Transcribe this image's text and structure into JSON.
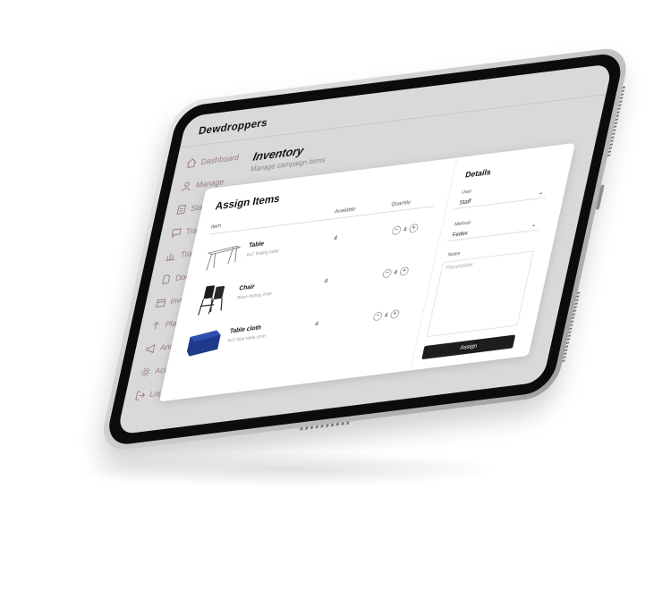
{
  "app": {
    "brand": "Dewdroppers"
  },
  "sidebar": {
    "items": [
      {
        "label": "Dashboard",
        "icon": "home-icon"
      },
      {
        "label": "Manage",
        "icon": "user-icon"
      },
      {
        "label": "Staff",
        "icon": "staff-icon"
      },
      {
        "label": "Training",
        "icon": "chat-icon"
      },
      {
        "label": "Training",
        "icon": "chart-icon"
      },
      {
        "label": "Documents",
        "icon": "document-icon"
      },
      {
        "label": "Inventory",
        "icon": "inventory-icon"
      },
      {
        "label": "Plan Upload",
        "icon": "upload-icon"
      },
      {
        "label": "Announcements",
        "icon": "megaphone-icon"
      },
      {
        "label": "Accounts",
        "icon": "gear-icon"
      },
      {
        "label": "Logout",
        "icon": "logout-icon"
      }
    ]
  },
  "main": {
    "title": "Inventory",
    "subtitle": "Manage campaign items"
  },
  "modal": {
    "title": "Assign Items",
    "columns": {
      "item": "Item",
      "available": "Available",
      "quantity": "Quantity"
    },
    "items": [
      {
        "name": "Table",
        "desc": "6x2' folding table",
        "available": "4",
        "quantity": "4",
        "image": "table-image"
      },
      {
        "name": "Chair",
        "desc": "Black folding chair",
        "available": "4",
        "quantity": "4",
        "image": "chair-image"
      },
      {
        "name": "Table cloth",
        "desc": "6x2' blue table cloth",
        "available": "4",
        "quantity": "4",
        "image": "tablecloth-image"
      }
    ],
    "details": {
      "title": "Details",
      "user_label": "User",
      "user_value": "Staff",
      "method_label": "Method",
      "method_value": "Fedex",
      "notes_label": "Notes",
      "notes_placeholder": "Placeholder",
      "assign_label": "Assign"
    },
    "stepper": {
      "minus": "−",
      "plus": "+"
    }
  },
  "colors": {
    "accent": "#9a7d86",
    "button": "#1d1d1d",
    "tablecloth": "#1f3a8a"
  }
}
